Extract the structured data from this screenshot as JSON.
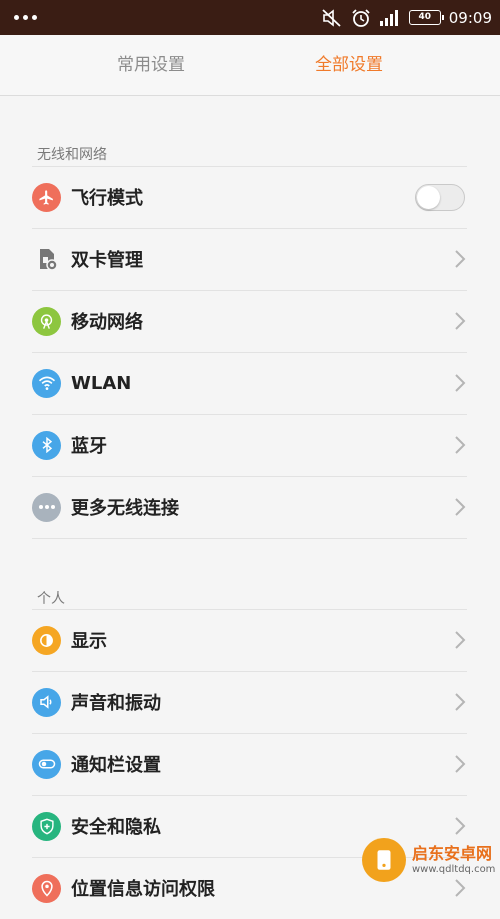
{
  "status_bar": {
    "time": "09:09",
    "battery": "40",
    "icons": [
      "overflow-dots-icon",
      "mute-icon",
      "alarm-icon",
      "signal-icon",
      "battery-icon"
    ]
  },
  "tabs": [
    {
      "label": "常用设置",
      "selected": false
    },
    {
      "label": "全部设置",
      "selected": true
    }
  ],
  "colors": {
    "accent": "#f07a2a",
    "status_bar_bg": "#3a1d14"
  },
  "sections": [
    {
      "title": "无线和网络",
      "items": [
        {
          "label": "飞行模式",
          "icon": "airplane-icon",
          "control": "toggle",
          "value": false
        },
        {
          "label": "双卡管理",
          "icon": "sim-card-icon",
          "control": "chevron"
        },
        {
          "label": "移动网络",
          "icon": "mobile-network-icon",
          "control": "chevron"
        },
        {
          "label": "WLAN",
          "icon": "wifi-icon",
          "control": "chevron"
        },
        {
          "label": "蓝牙",
          "icon": "bluetooth-icon",
          "control": "chevron"
        },
        {
          "label": "更多无线连接",
          "icon": "more-icon",
          "control": "chevron"
        }
      ]
    },
    {
      "title": "个人",
      "items": [
        {
          "label": "显示",
          "icon": "display-icon",
          "control": "chevron"
        },
        {
          "label": "声音和振动",
          "icon": "sound-icon",
          "control": "chevron"
        },
        {
          "label": "通知栏设置",
          "icon": "notification-icon",
          "control": "chevron"
        },
        {
          "label": "安全和隐私",
          "icon": "security-icon",
          "control": "chevron"
        },
        {
          "label": "位置信息访问权限",
          "icon": "location-icon",
          "control": "chevron"
        }
      ]
    }
  ],
  "watermark": {
    "text": "启东安卓网",
    "url": "www.qdltdq.com"
  }
}
